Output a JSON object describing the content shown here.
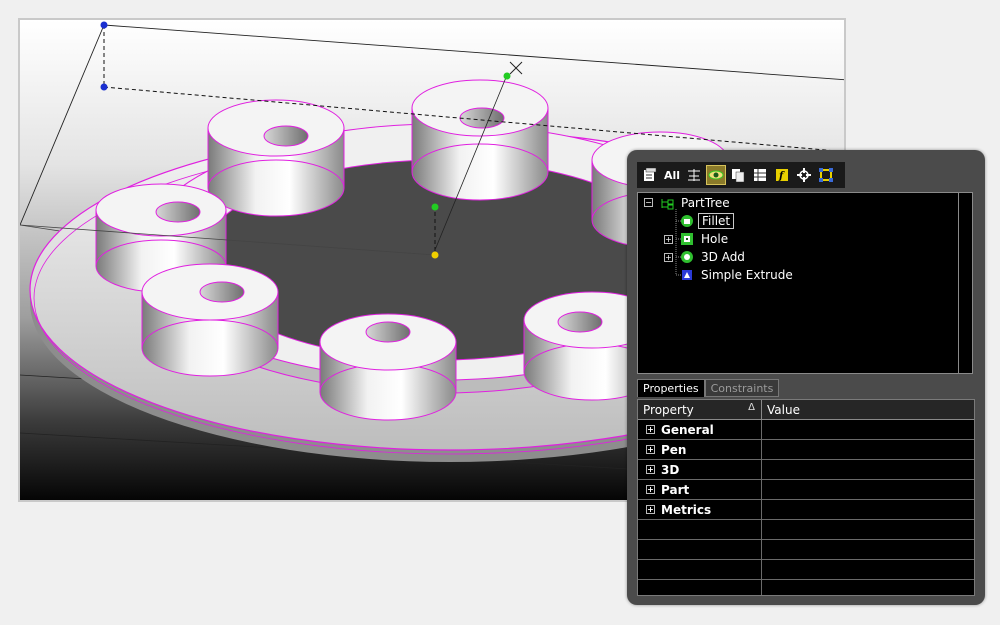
{
  "toolbar": {
    "all_label": "All",
    "icons": [
      "properties-icon",
      "all-icon",
      "show-hide-icon",
      "visibility-icon",
      "copy-icon",
      "table-icon",
      "function-icon",
      "tree-settings-icon",
      "select-frame-icon"
    ]
  },
  "tree": {
    "root": "PartTree",
    "items": [
      {
        "label": "Fillet",
        "icon": "fillet-icon",
        "expandable": false,
        "selected": true
      },
      {
        "label": "Hole",
        "icon": "hole-icon",
        "expandable": true,
        "selected": false
      },
      {
        "label": "3D Add",
        "icon": "3d-add-icon",
        "expandable": true,
        "selected": false
      },
      {
        "label": "Simple Extrude",
        "icon": "extrude-icon",
        "expandable": false,
        "selected": false
      }
    ]
  },
  "tabs": [
    "Properties",
    "Constraints"
  ],
  "grid": {
    "header_property": "Property",
    "header_sort": "Δ",
    "header_value": "Value",
    "rows": [
      {
        "property": "General",
        "value": ""
      },
      {
        "property": "Pen",
        "value": ""
      },
      {
        "property": "3D",
        "value": ""
      },
      {
        "property": "Part",
        "value": ""
      },
      {
        "property": "Metrics",
        "value": ""
      }
    ]
  },
  "colors": {
    "wireframe": "#e020e0",
    "handle_blue": "#1a2fd0",
    "handle_green": "#22cc22",
    "handle_yellow": "#f0d000"
  }
}
